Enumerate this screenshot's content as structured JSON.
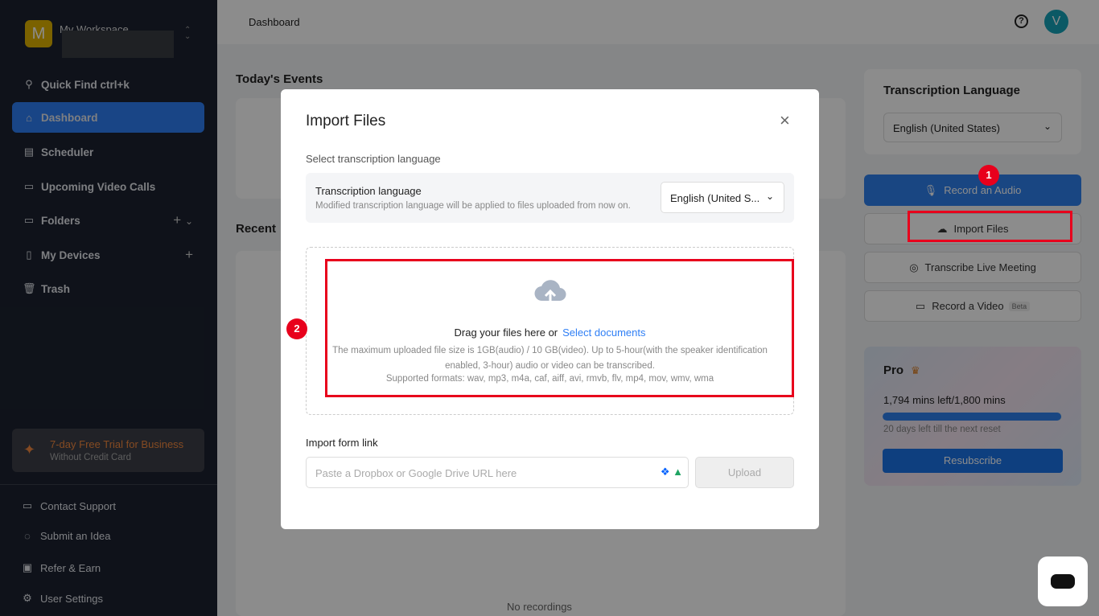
{
  "sidebar": {
    "workspace_initial": "M",
    "workspace_name": "My Workspace",
    "items": [
      {
        "label": "Quick Find ctrl+k",
        "icon": "search-icon"
      },
      {
        "label": "Dashboard",
        "icon": "home-icon"
      },
      {
        "label": "Scheduler",
        "icon": "calendar-plus-icon"
      },
      {
        "label": "Upcoming Video Calls",
        "icon": "calendar-icon"
      },
      {
        "label": "Folders",
        "icon": "folder-icon"
      },
      {
        "label": "My Devices",
        "icon": "device-icon"
      },
      {
        "label": "Trash",
        "icon": "trash-icon"
      }
    ],
    "trial": {
      "title": "7-day Free Trial for Business",
      "subtitle": "Without Credit Card"
    },
    "bottom": [
      {
        "label": "Contact Support"
      },
      {
        "label": "Submit an Idea"
      },
      {
        "label": "Refer & Earn"
      },
      {
        "label": "User Settings"
      }
    ]
  },
  "header": {
    "breadcrumb": "Dashboard",
    "help": "?",
    "user_initial": "V"
  },
  "main": {
    "todays_events": "Today's Events",
    "recent": "Recent",
    "no_recordings": "No recordings"
  },
  "right": {
    "lang_title": "Transcription Language",
    "lang_value": "English (United States)",
    "record_audio": "Record an Audio",
    "import_files": "Import Files",
    "live_meeting": "Transcribe Live Meeting",
    "record_video": "Record a Video",
    "beta": "Beta",
    "pro": {
      "title": "Pro",
      "mins": "1,794 mins left/1,800 mins",
      "progress_fraction": 0.9967,
      "reset": "20 days left till the next reset",
      "resubscribe": "Resubscribe"
    }
  },
  "modal": {
    "title": "Import Files",
    "close": "×",
    "select_lang_label": "Select transcription language",
    "lang_label": "Transcription language",
    "lang_note": "Modified transcription language will be applied to files uploaded from now on.",
    "lang_value": "English (United S...",
    "drag_text": "Drag your files here or",
    "select_docs": "Select documents",
    "limit_text": "The maximum uploaded file size is 1GB(audio) / 10 GB(video). Up to 5-hour(with the speaker identification enabled, 3-hour) audio or video can be transcribed.",
    "formats": "Supported formats: wav, mp3, m4a, caf, aiff, avi, rmvb, flv, mp4, mov, wmv, wma",
    "link_label": "Import form link",
    "url_placeholder": "Paste a Dropbox or Google Drive URL here",
    "upload": "Upload"
  },
  "annotations": {
    "badge1": "1",
    "badge2": "2",
    "color": "#e8001c"
  }
}
